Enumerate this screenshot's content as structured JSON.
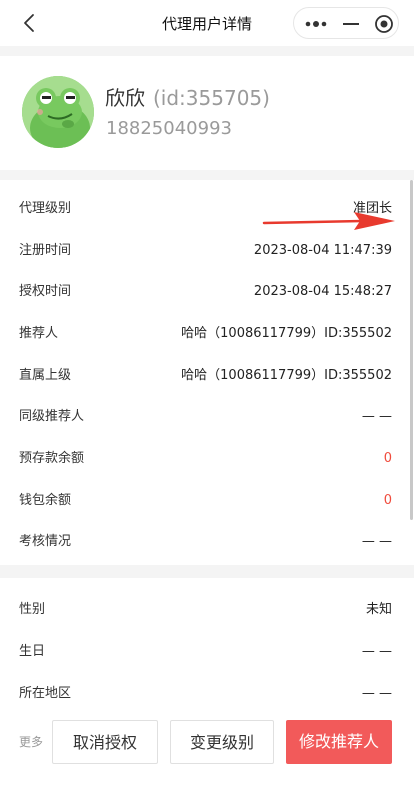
{
  "nav": {
    "title": "代理用户详情"
  },
  "profile": {
    "name": "欣欣",
    "id_text": "(id:355705)",
    "phone": "18825040993"
  },
  "info_rows": [
    {
      "label": "代理级别",
      "value": "准团长"
    },
    {
      "label": "注册时间",
      "value": "2023-08-04 11:47:39"
    },
    {
      "label": "授权时间",
      "value": "2023-08-04 15:48:27"
    },
    {
      "label": "推荐人",
      "value": "哈哈（10086117799）ID:355502"
    },
    {
      "label": "直属上级",
      "value": "哈哈（10086117799）ID:355502"
    },
    {
      "label": "同级推荐人",
      "value": "— —"
    },
    {
      "label": "预存款余额",
      "value": "0"
    },
    {
      "label": "钱包余额",
      "value": "0"
    },
    {
      "label": "考核情况",
      "value": "— —"
    }
  ],
  "info2_rows": [
    {
      "label": "性别",
      "value": "未知"
    },
    {
      "label": "生日",
      "value": "— —"
    },
    {
      "label": "所在地区",
      "value": "— —"
    }
  ],
  "actions": {
    "more_label": "更多",
    "cancel_auth": "取消授权",
    "change_level": "变更级别",
    "modify_referrer": "修改推荐人"
  },
  "colors": {
    "accent": "#f25a5a",
    "value_red": "#f04b3c",
    "arrow": "#e83a2e"
  },
  "icons": [
    "back-icon",
    "more-dots-icon",
    "minimize-icon",
    "close-target-icon",
    "arrow-annotation-icon",
    "frog-avatar"
  ]
}
